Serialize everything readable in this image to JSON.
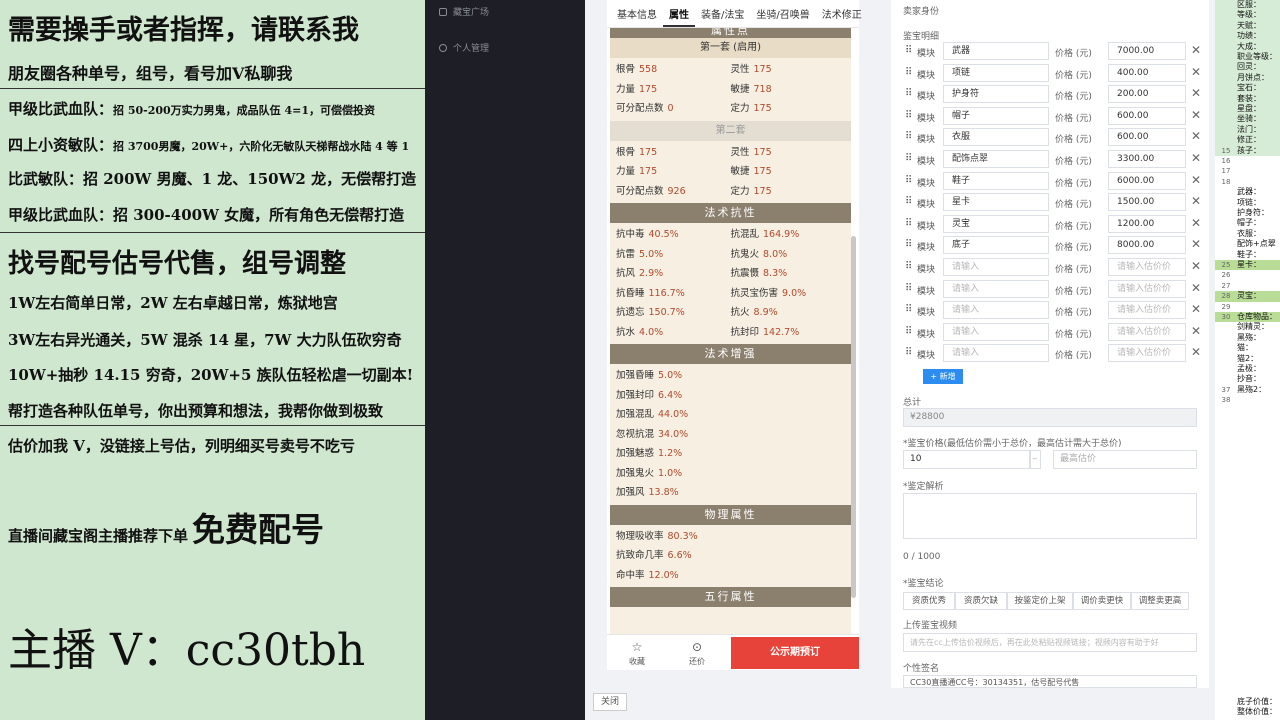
{
  "promo": {
    "line1": "需要操手或者指挥，请联系我",
    "line2": "朋友圈各种单号，组号，看号加V私聊我",
    "line3_a": "甲级比武血队：",
    "line3_b": "招 50-200万实力男鬼，成品队伍 4=1，可偿偿投资",
    "line4_a": "四上小资敏队：",
    "line4_b": "招 3700男魔，20W+，六阶化无敏队天梯帮战水陆 4 等 1",
    "line5": "比武敏队：招 200W 男魔、1 龙、150W2 龙，无偿帮打造",
    "line6": "甲级比武血队：招 300-400W 女魔，所有角色无偿帮打造",
    "line7": "找号配号估号代售，组号调整",
    "line8": "1W左右简单日常，2W 左右卓越日常，炼狱地宫",
    "line9": "3W左右异光通关，5W 混杀 14 星，7W 大力队伍砍穷奇",
    "line10": "10W+抽秒 14.15 穷奇，20W+5 族队伍轻松虐一切副本!",
    "line11": "帮打造各种队伍单号，你出预算和想法，我帮你做到极致",
    "line12": "估价加我 V，没链接上号估，列明细买号卖号不吃亏",
    "line13_a": "直播间藏宝阁主播推荐下单",
    "line13_b": "免费配号",
    "line14": "主播 V：cc30tbh"
  },
  "darknav": {
    "item1": "藏宝广场",
    "item2": "个人管理"
  },
  "tabs": [
    "基本信息",
    "属性",
    "装备/法宝",
    "坐骑/召唤兽",
    "法术修正"
  ],
  "active_tab": "属性",
  "attributes": {
    "title": "属性点",
    "set1_label": "第一套 (启用)",
    "set1": [
      {
        "k": "根骨",
        "v": "558"
      },
      {
        "k": "灵性",
        "v": "175"
      },
      {
        "k": "力量",
        "v": "175"
      },
      {
        "k": "敏捷",
        "v": "718"
      },
      {
        "k": "可分配点数",
        "v": "0"
      },
      {
        "k": "定力",
        "v": "175"
      }
    ],
    "set2_label": "第二套",
    "set2": [
      {
        "k": "根骨",
        "v": "175"
      },
      {
        "k": "灵性",
        "v": "175"
      },
      {
        "k": "力量",
        "v": "175"
      },
      {
        "k": "敏捷",
        "v": "175"
      },
      {
        "k": "可分配点数",
        "v": "926"
      },
      {
        "k": "定力",
        "v": "175"
      }
    ]
  },
  "resist": {
    "title": "法术抗性",
    "items": [
      {
        "k": "抗中毒",
        "v": "40.5%"
      },
      {
        "k": "抗混乱",
        "v": "164.9%"
      },
      {
        "k": "抗雷",
        "v": "5.0%"
      },
      {
        "k": "抗鬼火",
        "v": "8.0%"
      },
      {
        "k": "抗风",
        "v": "2.9%"
      },
      {
        "k": "抗震慑",
        "v": "8.3%"
      },
      {
        "k": "抗昏睡",
        "v": "116.7%"
      },
      {
        "k": "抗灵宝伤害",
        "v": "9.0%"
      },
      {
        "k": "抗遗忘",
        "v": "150.7%"
      },
      {
        "k": "抗火",
        "v": "8.9%"
      },
      {
        "k": "抗水",
        "v": "4.0%"
      },
      {
        "k": "抗封印",
        "v": "142.7%"
      }
    ]
  },
  "boost": {
    "title": "法术增强",
    "items": [
      {
        "k": "加强昏睡",
        "v": "5.0%"
      },
      {
        "k": "加强封印",
        "v": "6.4%"
      },
      {
        "k": "加强混乱",
        "v": "44.0%"
      },
      {
        "k": "忽视抗混",
        "v": "34.0%"
      },
      {
        "k": "加强魅惑",
        "v": "1.2%"
      },
      {
        "k": "加强鬼火",
        "v": "1.0%"
      },
      {
        "k": "加强风",
        "v": "13.8%"
      }
    ]
  },
  "physical": {
    "title": "物理属性",
    "items": [
      {
        "k": "物理吸收率",
        "v": "80.3%"
      },
      {
        "k": "抗致命几率",
        "v": "6.6%"
      },
      {
        "k": "命中率",
        "v": "12.0%"
      }
    ]
  },
  "five": {
    "title": "五行属性"
  },
  "bottombar": {
    "fav": "收藏",
    "bargain": "还价",
    "buy": "公示期预订"
  },
  "close_label": "关闭",
  "form": {
    "header": "卖家身份",
    "detail_label": "鉴宝明细",
    "module_label": "模块",
    "price_label": "价格 (元)",
    "rows": [
      {
        "name": "武器",
        "price": "7000.00",
        "ph": false
      },
      {
        "name": "项链",
        "price": "400.00",
        "ph": false
      },
      {
        "name": "护身符",
        "price": "200.00",
        "ph": false
      },
      {
        "name": "帽子",
        "price": "600.00",
        "ph": false
      },
      {
        "name": "衣服",
        "price": "600.00",
        "ph": false
      },
      {
        "name": "配饰点翠",
        "price": "3300.00",
        "ph": false
      },
      {
        "name": "鞋子",
        "price": "6000.00",
        "ph": false
      },
      {
        "name": "星卡",
        "price": "1500.00",
        "ph": false
      },
      {
        "name": "灵宝",
        "price": "1200.00",
        "ph": false
      },
      {
        "name": "底子",
        "price": "8000.00",
        "ph": false
      },
      {
        "name": "请输入",
        "price": "请输入估价价",
        "ph": true
      },
      {
        "name": "请输入",
        "price": "请输入估价价",
        "ph": true
      },
      {
        "name": "请输入",
        "price": "请输入估价价",
        "ph": true
      },
      {
        "name": "请输入",
        "price": "请输入估价价",
        "ph": true
      },
      {
        "name": "请输入",
        "price": "请输入估价价",
        "ph": true
      }
    ],
    "add_label": "+ 新增",
    "total_label": "总计",
    "total_value": "¥28800",
    "price_range_label": "*鉴宝价格(最低估价需小于总价，最高估计需大于总价)",
    "min_value": "10",
    "max_placeholder": "最高估价",
    "analysis_label": "*鉴定解析",
    "counter": "0 / 1000",
    "conclusion_label": "*鉴宝结论",
    "tags": [
      "资质优秀",
      "资质欠缺",
      "按鉴定价上架",
      "调价卖更快",
      "调整卖更高"
    ],
    "video_label": "上传鉴宝视频",
    "video_placeholder": "请先在cc上传估价视频后，再在此处粘贴视频链接；视频内容有助于好",
    "sign_label": "个性签名",
    "sign_value": "CC30直播通CC号：30134351，估号配号代售"
  },
  "sheet": {
    "rows": [
      {
        "n": "",
        "t": "区服："
      },
      {
        "n": "",
        "t": "等级："
      },
      {
        "n": "",
        "t": "天赋："
      },
      {
        "n": "",
        "t": "功绩："
      },
      {
        "n": "",
        "t": "大成："
      },
      {
        "n": "",
        "t": "职业等级："
      },
      {
        "n": "",
        "t": "回灵："
      },
      {
        "n": "",
        "t": "月饼点："
      },
      {
        "n": "",
        "t": "宝石："
      },
      {
        "n": "",
        "t": "套装："
      },
      {
        "n": "",
        "t": "星盘："
      },
      {
        "n": "",
        "t": "坐骑："
      },
      {
        "n": "",
        "t": "法门："
      },
      {
        "n": "",
        "t": "修正："
      },
      {
        "n": "15",
        "t": "孩子："
      },
      {
        "n": "16",
        "t": ""
      },
      {
        "n": "17",
        "t": ""
      },
      {
        "n": "18",
        "t": ""
      },
      {
        "n": "",
        "t": "武器："
      },
      {
        "n": "",
        "t": "项链："
      },
      {
        "n": "",
        "t": "护身符："
      },
      {
        "n": "",
        "t": "帽子："
      },
      {
        "n": "",
        "t": "衣服："
      },
      {
        "n": "",
        "t": "配饰+点翠"
      },
      {
        "n": "",
        "t": "鞋子："
      },
      {
        "n": "25",
        "t": "星卡："
      },
      {
        "n": "26",
        "t": ""
      },
      {
        "n": "27",
        "t": ""
      },
      {
        "n": "28",
        "t": "灵宝："
      },
      {
        "n": "29",
        "t": ""
      },
      {
        "n": "30",
        "t": "仓库物品："
      },
      {
        "n": "",
        "t": "剑精灵："
      },
      {
        "n": "",
        "t": "黑殇："
      },
      {
        "n": "",
        "t": "猫："
      },
      {
        "n": "",
        "t": "猫2："
      },
      {
        "n": "",
        "t": "孟极："
      },
      {
        "n": "",
        "t": "抄音："
      },
      {
        "n": "37",
        "t": "黑殇2："
      },
      {
        "n": "38",
        "t": ""
      },
      {
        "n": "",
        "t": ""
      },
      {
        "n": "",
        "t": ""
      },
      {
        "n": "",
        "t": ""
      },
      {
        "n": "",
        "t": ""
      },
      {
        "n": "",
        "t": ""
      },
      {
        "n": "",
        "t": ""
      },
      {
        "n": "",
        "t": ""
      },
      {
        "n": "",
        "t": ""
      },
      {
        "n": "",
        "t": ""
      },
      {
        "n": "",
        "t": ""
      },
      {
        "n": "",
        "t": ""
      },
      {
        "n": "",
        "t": ""
      },
      {
        "n": "",
        "t": ""
      },
      {
        "n": "",
        "t": ""
      },
      {
        "n": "",
        "t": ""
      },
      {
        "n": "",
        "t": ""
      },
      {
        "n": "",
        "t": ""
      },
      {
        "n": "",
        "t": ""
      },
      {
        "n": "",
        "t": ""
      },
      {
        "n": "",
        "t": ""
      },
      {
        "n": "",
        "t": ""
      },
      {
        "n": "",
        "t": ""
      },
      {
        "n": "",
        "t": ""
      },
      {
        "n": "",
        "t": ""
      },
      {
        "n": "",
        "t": ""
      },
      {
        "n": "",
        "t": ""
      },
      {
        "n": "",
        "t": ""
      },
      {
        "n": "",
        "t": ""
      },
      {
        "n": "",
        "t": "底子价值："
      },
      {
        "n": "",
        "t": "整体价值："
      }
    ]
  },
  "colors": {
    "accent": "#e8433a",
    "section": "#8b7f6e",
    "value": "#b34a2c",
    "promo_bg": "#cfe6cf",
    "link": "#2d8cf0"
  }
}
